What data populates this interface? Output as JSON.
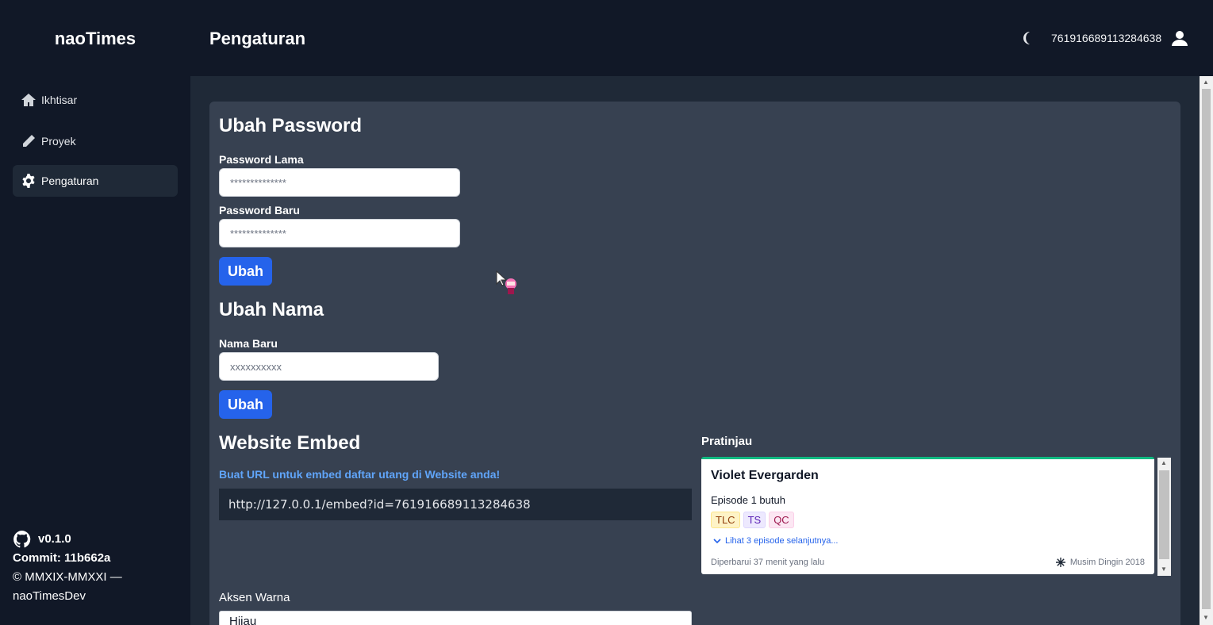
{
  "app": {
    "brand": "naoTimes",
    "page_title": "Pengaturan"
  },
  "header": {
    "user_id": "761916689113284638"
  },
  "sidebar": {
    "items": [
      {
        "label": "Ikhtisar",
        "icon": "home-icon"
      },
      {
        "label": "Proyek",
        "icon": "pencil-icon"
      },
      {
        "label": "Pengaturan",
        "icon": "gear-icon",
        "active": true
      }
    ],
    "footer": {
      "version": "v0.1.0",
      "commit": "Commit: 11b662a",
      "copyright": "© MMXIX-MMXXI — naoTimesDev"
    }
  },
  "password_section": {
    "title": "Ubah Password",
    "old_label": "Password Lama",
    "old_placeholder": "**************",
    "new_label": "Password Baru",
    "new_placeholder": "**************",
    "button": "Ubah"
  },
  "name_section": {
    "title": "Ubah Nama",
    "label": "Nama Baru",
    "placeholder": "xxxxxxxxxx",
    "button": "Ubah"
  },
  "embed_section": {
    "title": "Website Embed",
    "subtitle": "Buat URL untuk embed daftar utang di Website anda!",
    "url": "http://127.0.0.1/embed?id=761916689113284638",
    "accent_label": "Aksen Warna",
    "accent_value": "Hijau"
  },
  "preview": {
    "label": "Pratinjau",
    "title": "Violet Evergarden",
    "episode": "Episode 1 butuh",
    "badges": [
      "TLC",
      "TS",
      "QC"
    ],
    "more": "Lihat 3 episode selanjutnya...",
    "updated": "Diperbarui 37 menit yang lalu",
    "season": "Musim Dingin 2018",
    "accent_color": "#10b981"
  },
  "colors": {
    "bg": "#111827",
    "main": "#1f2937",
    "card": "#374151",
    "primary": "#2563eb",
    "link": "#60a5fa"
  }
}
